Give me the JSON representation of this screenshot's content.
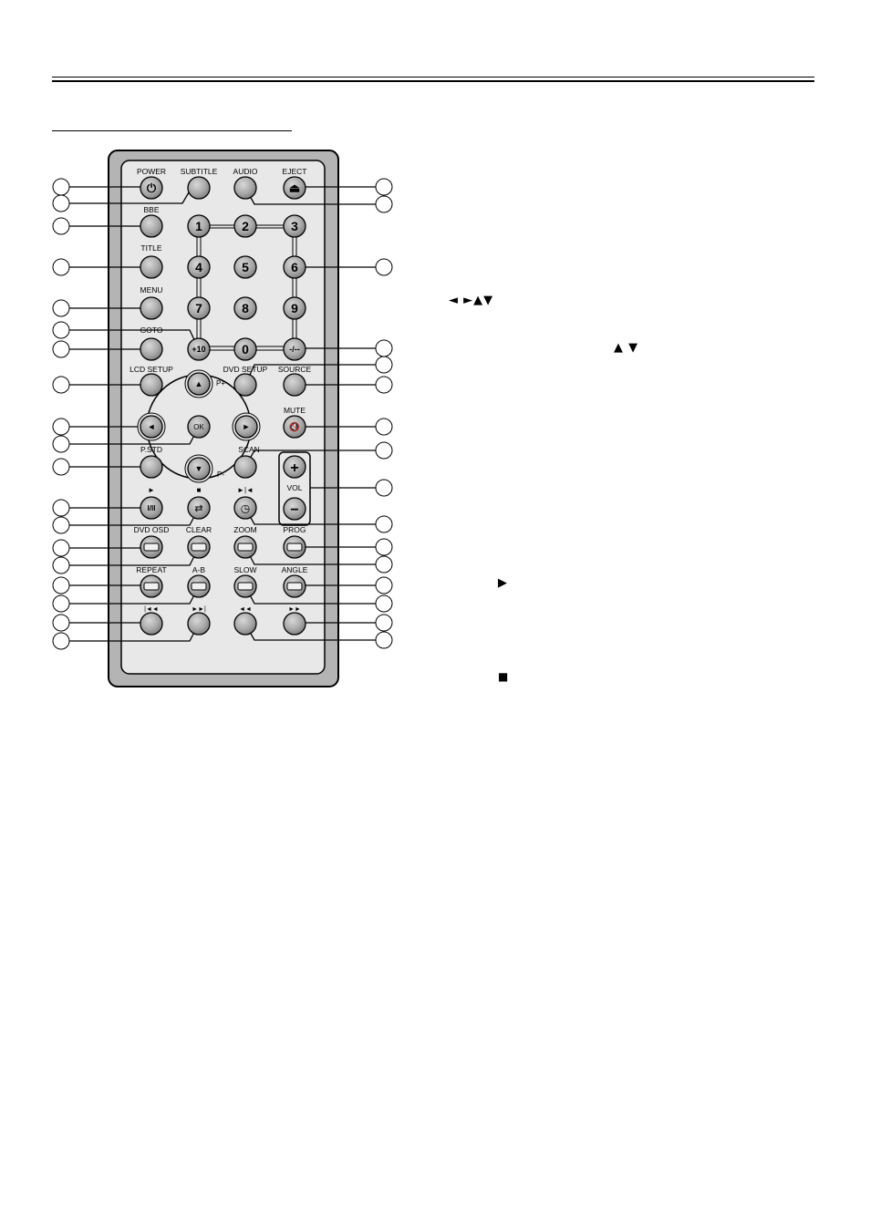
{
  "header": {
    "rules": "double-horizontal-rule",
    "section_underline": "section-title-underline"
  },
  "remote": {
    "top_row": [
      {
        "id": "power",
        "label": "POWER",
        "icon": "power-icon",
        "glyph": "⏻"
      },
      {
        "id": "subtitle",
        "label": "SUBTITLE",
        "icon": "",
        "glyph": ""
      },
      {
        "id": "audio",
        "label": "AUDIO",
        "icon": "",
        "glyph": ""
      },
      {
        "id": "eject",
        "label": "EJECT",
        "icon": "eject-icon",
        "glyph": "⏏"
      }
    ],
    "left_column": [
      {
        "id": "bbe",
        "label": "BBE"
      },
      {
        "id": "title",
        "label": "TITLE"
      },
      {
        "id": "menu",
        "label": "MENU"
      },
      {
        "id": "goto",
        "label": "GOTO"
      },
      {
        "id": "lcd-setup",
        "label": "LCD SETUP"
      }
    ],
    "numpad": [
      "1",
      "2",
      "3",
      "4",
      "5",
      "6",
      "7",
      "8",
      "9",
      "+10",
      "0",
      "-/--"
    ],
    "nav": {
      "up": "▲",
      "down": "▼",
      "left": "◄",
      "right": "►",
      "ok": "OK",
      "p_plus": "P+",
      "p_minus": "P-"
    },
    "dvd_setup": "DVD SETUP",
    "source": "SOURCE",
    "mute": "MUTE",
    "pstd": "P.STD",
    "scan": "SCAN",
    "vol": {
      "label": "VOL",
      "plus": "+",
      "minus": "−"
    },
    "transport_top_glyphs": {
      "play": "►",
      "stop": "■",
      "step": "►|◄"
    },
    "transport_buttons": {
      "play_pause": "I/II",
      "repeat_loop": "⇄",
      "timer": "◷"
    },
    "function_rows": [
      [
        {
          "id": "dvd-osd",
          "label": "DVD OSD"
        },
        {
          "id": "clear",
          "label": "CLEAR"
        },
        {
          "id": "zoom",
          "label": "ZOOM"
        },
        {
          "id": "prog",
          "label": "PROG"
        }
      ],
      [
        {
          "id": "repeat",
          "label": "REPEAT"
        },
        {
          "id": "a-b",
          "label": "A-B"
        },
        {
          "id": "slow",
          "label": "SLOW"
        },
        {
          "id": "angle",
          "label": "ANGLE"
        }
      ]
    ],
    "skip_glyphs": [
      "|◄◄",
      "►►|",
      "◄◄",
      "►►"
    ]
  },
  "description": {
    "arrows_glyphs": "◄ ►▲▼",
    "updown_glyphs": "▲ ▼",
    "play_glyph": "▶",
    "stop_glyph": "■"
  }
}
